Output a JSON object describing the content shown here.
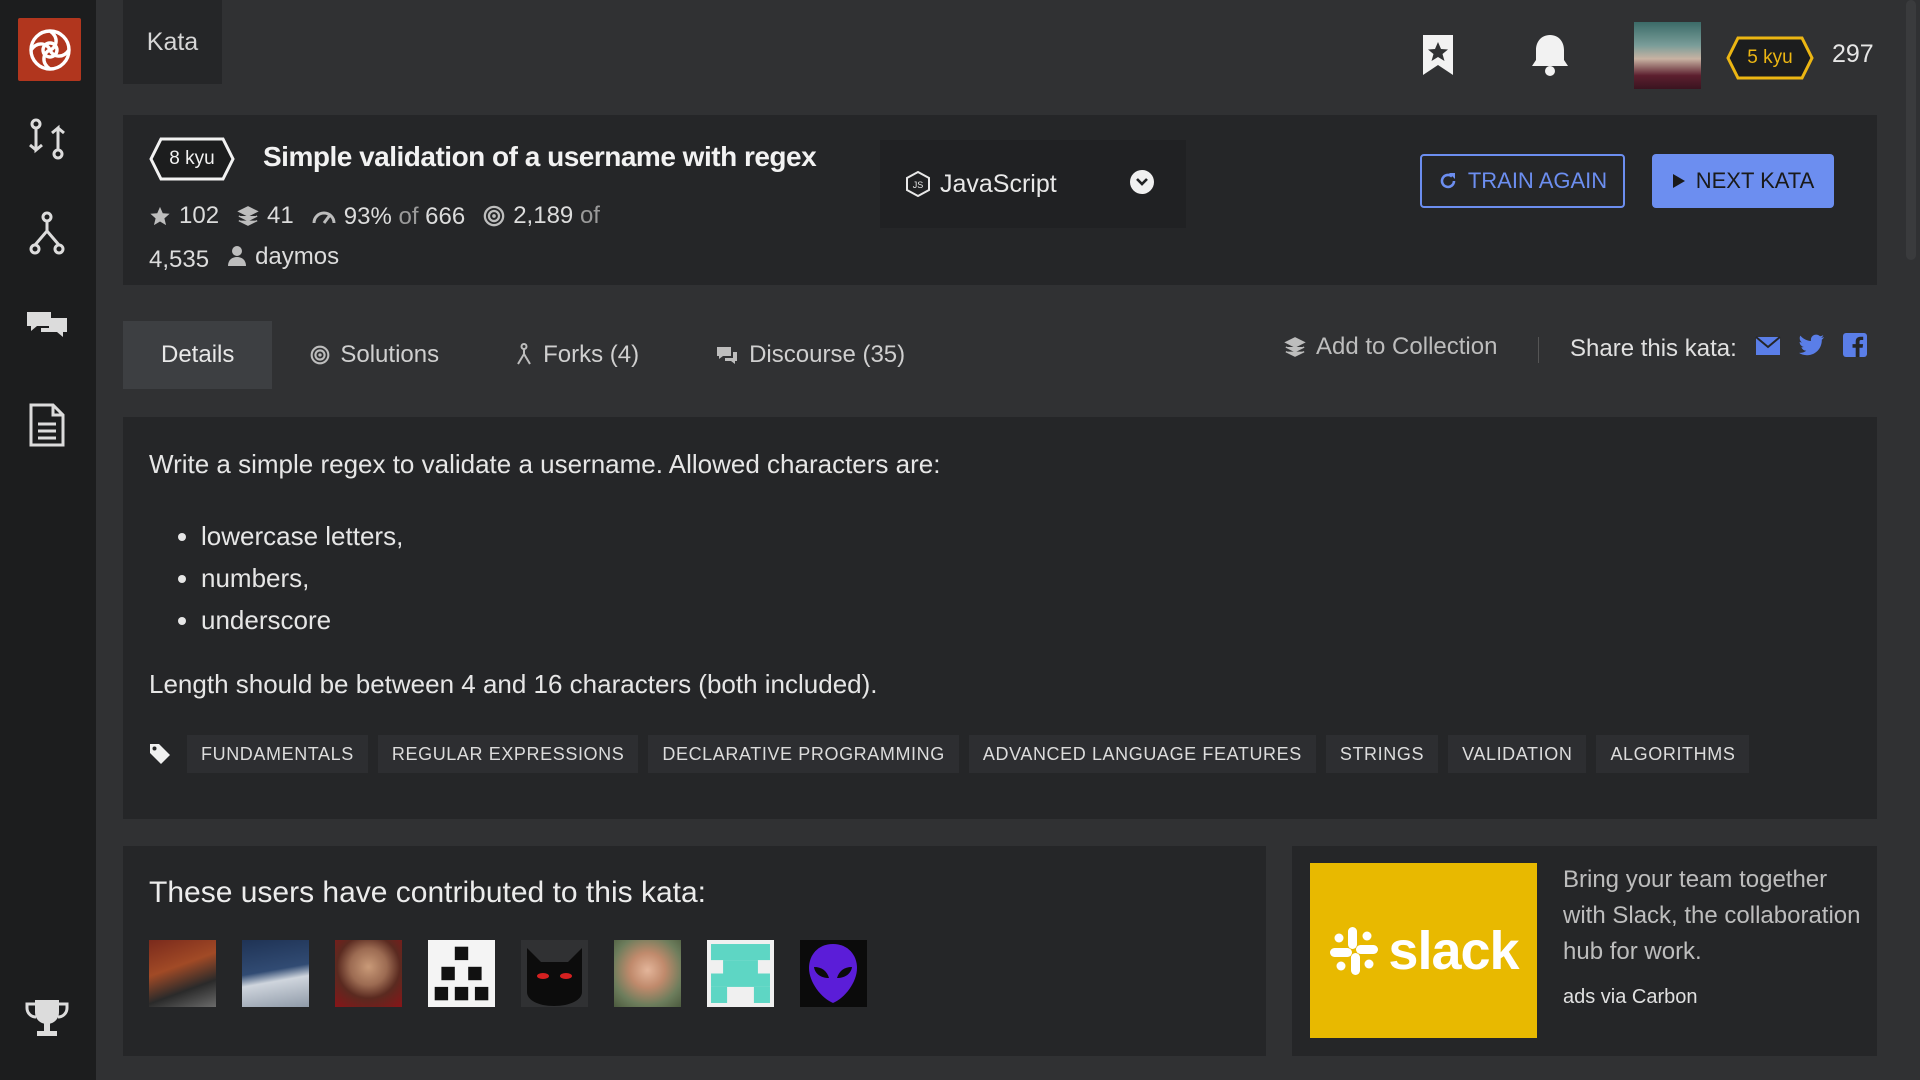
{
  "nav": {
    "kata_tab": "Kata",
    "user": {
      "rank": "5 kyu",
      "honor": "297"
    }
  },
  "kata": {
    "rank": "8 kyu",
    "title": "Simple validation of a username with regex",
    "stars": "102",
    "collections": "41",
    "satisfaction_pct": "93%",
    "satisfaction_of": "of",
    "votes": "666",
    "completed": "2,189",
    "completed_of": "of",
    "attempted": "4,535",
    "author": "daymos",
    "language": "JavaScript",
    "train_again": "TRAIN AGAIN",
    "next_kata": "NEXT KATA"
  },
  "tabs": [
    {
      "label": "Details",
      "active": true
    },
    {
      "label": "Solutions"
    },
    {
      "label": "Forks (4)"
    },
    {
      "label": "Discourse (35)"
    }
  ],
  "actions": {
    "add_collection": "Add to Collection",
    "share_label": "Share this kata:"
  },
  "description": {
    "intro": "Write a simple regex to validate a username. Allowed characters are:",
    "items": [
      "lowercase letters,",
      "numbers,",
      "underscore"
    ],
    "length_rule": "Length should be between 4 and 16 characters (both included)."
  },
  "tags": [
    "FUNDAMENTALS",
    "REGULAR EXPRESSIONS",
    "DECLARATIVE PROGRAMMING",
    "ADVANCED LANGUAGE FEATURES",
    "STRINGS",
    "VALIDATION",
    "ALGORITHMS"
  ],
  "contributors": {
    "heading": "These users have contributed to this kata:"
  },
  "ad": {
    "brand": "slack",
    "text": "Bring your team together with Slack, the collaboration hub for work.",
    "via": "ads via Carbon"
  },
  "colors": {
    "accent": "#6c8ef0",
    "rank_yellow": "#ecb613",
    "logo_red": "#b1361e",
    "slack_bg": "#e8b900"
  }
}
